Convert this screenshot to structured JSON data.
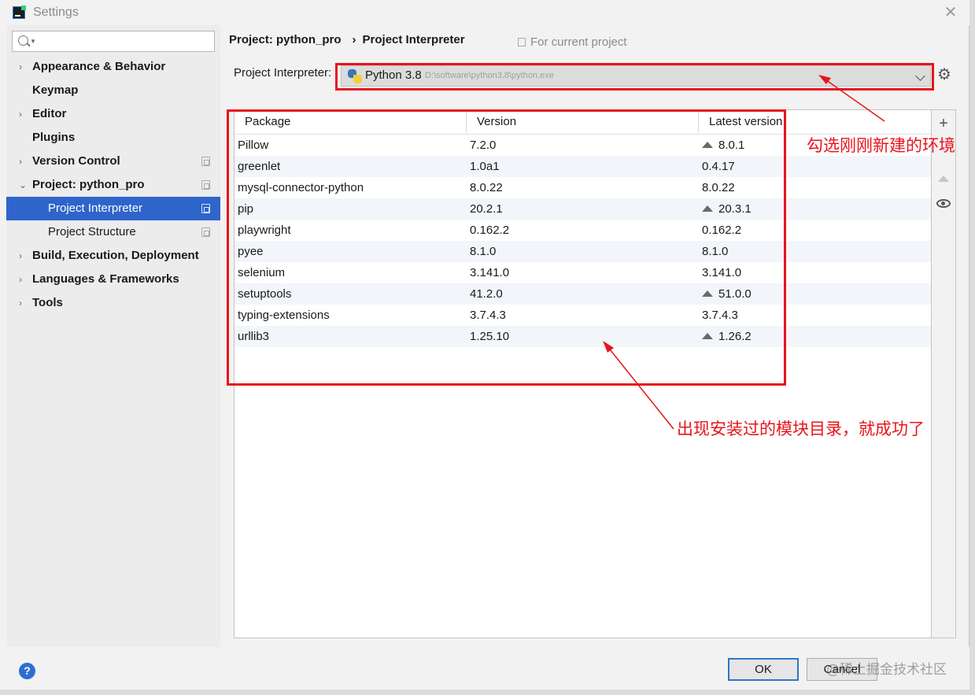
{
  "window": {
    "title": "Settings",
    "close": "✕"
  },
  "sidebar": {
    "search_placeholder": "",
    "items": [
      {
        "label": "Appearance & Behavior",
        "arrow": "›"
      },
      {
        "label": "Keymap"
      },
      {
        "label": "Editor",
        "arrow": "›"
      },
      {
        "label": "Plugins"
      },
      {
        "label": "Version Control",
        "arrow": "›"
      },
      {
        "label": "Project: python_pro",
        "arrow": "⌄"
      },
      {
        "label": "Project Interpreter",
        "selected": true
      },
      {
        "label": "Project Structure"
      },
      {
        "label": "Build, Execution, Deployment",
        "arrow": "›"
      },
      {
        "label": "Languages & Frameworks",
        "arrow": "›"
      },
      {
        "label": "Tools",
        "arrow": "›"
      }
    ]
  },
  "header": {
    "crumb_project": "Project: python_pro",
    "crumb_sep": "›",
    "crumb_page": "Project Interpreter",
    "for_current": "For current project"
  },
  "interpreter": {
    "label": "Project Interpreter:",
    "name": "Python 3.8",
    "path": "D:\\software\\python3.8\\python.exe"
  },
  "table": {
    "columns": [
      "Package",
      "Version",
      "Latest version"
    ],
    "rows": [
      {
        "package": "Pillow",
        "version": "7.2.0",
        "latest": "8.0.1",
        "upgrade": true
      },
      {
        "package": "greenlet",
        "version": "1.0a1",
        "latest": "0.4.17",
        "upgrade": false
      },
      {
        "package": "mysql-connector-python",
        "version": "8.0.22",
        "latest": "8.0.22",
        "upgrade": false
      },
      {
        "package": "pip",
        "version": "20.2.1",
        "latest": "20.3.1",
        "upgrade": true
      },
      {
        "package": "playwright",
        "version": "0.162.2",
        "latest": "0.162.2",
        "upgrade": false
      },
      {
        "package": "pyee",
        "version": "8.1.0",
        "latest": "8.1.0",
        "upgrade": false
      },
      {
        "package": "selenium",
        "version": "3.141.0",
        "latest": "3.141.0",
        "upgrade": false
      },
      {
        "package": "setuptools",
        "version": "41.2.0",
        "latest": "51.0.0",
        "upgrade": true
      },
      {
        "package": "typing-extensions",
        "version": "3.7.4.3",
        "latest": "3.7.4.3",
        "upgrade": false
      },
      {
        "package": "urllib3",
        "version": "1.25.10",
        "latest": "1.26.2",
        "upgrade": true
      }
    ]
  },
  "toolbar": {
    "add": "+",
    "remove": "−"
  },
  "annotations": {
    "note1": "勾选刚刚新建的环境",
    "note2": "出现安装过的模块目录，就成功了",
    "color": "#e8141b"
  },
  "footer": {
    "help": "?",
    "ok": "OK",
    "cancel": "Cancel",
    "watermark": "@稀土掘金技术社区"
  }
}
